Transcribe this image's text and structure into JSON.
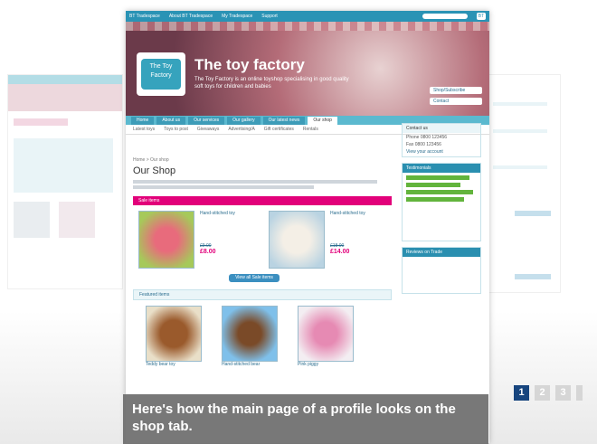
{
  "topbar": {
    "brand": "BT Tradespace",
    "links": [
      "About BT Tradespace",
      "My Tradespace",
      "Support"
    ],
    "logo": "BT"
  },
  "shop": {
    "title": "The toy factory",
    "logo_text": "The Toy Factory",
    "description": "The Toy Factory is an online toyshop specialising in good quality soft toys for children and babies",
    "buttons": [
      "Shop/Subscribe",
      "Contact"
    ]
  },
  "tabs": [
    "Home",
    "About us",
    "Our services",
    "Our gallery",
    "Our latest news",
    "Our shop"
  ],
  "subnav": [
    "Latest toys",
    "Toys to post",
    "Giveaways",
    "Advertising/A",
    "Gift certificates",
    "Rentals"
  ],
  "breadcrumb": "Home > Our shop",
  "page_title": "Our Shop",
  "sale_section": {
    "title": "Sale items",
    "button": "View all Sale items",
    "items": [
      {
        "name": "Hand-stitched toy",
        "was": "£9.00",
        "now": "£8.00"
      },
      {
        "name": "Hand-stitched toy",
        "was": "£18.00",
        "now": "£14.00"
      }
    ]
  },
  "featured_section": {
    "title": "Featured items",
    "items": [
      {
        "name": "Teddy bear toy"
      },
      {
        "name": "Hand-stitched bear"
      },
      {
        "name": "Pink piggy"
      }
    ]
  },
  "sidebar": {
    "contact_title": "Contact us",
    "contact_lines": [
      "Phone 0800 123456",
      "Fax 0800 123456"
    ],
    "view_account": "View your account",
    "testimonials_title": "Testimonials",
    "reviews_title": "Reviews on Trade"
  },
  "caption": "Here's how the main page of a profile looks on the shop tab.",
  "pager": {
    "pages": [
      "1",
      "2",
      "3",
      ""
    ],
    "active": "1"
  },
  "colors": {
    "accent": "#2a93b5",
    "sale": "#e2007a",
    "pager_active": "#17457e"
  }
}
